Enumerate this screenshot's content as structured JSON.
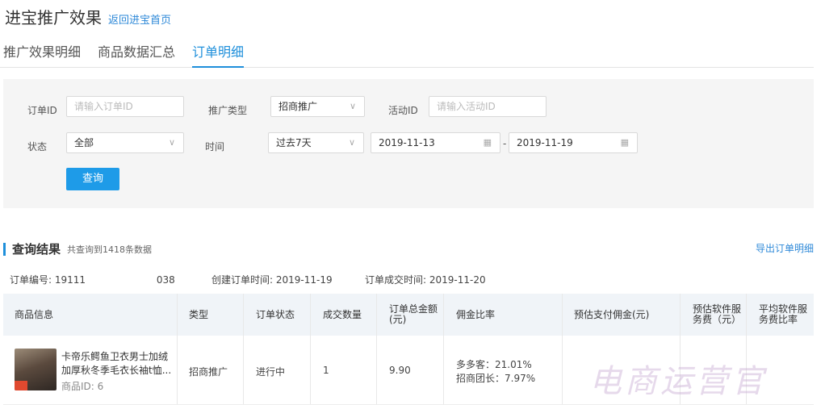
{
  "header": {
    "title": "进宝推广效果",
    "back_link": "返回进宝首页"
  },
  "tabs": [
    "推广效果明细",
    "商品数据汇总",
    "订单明细"
  ],
  "active_tab": "订单明细",
  "filters": {
    "order_id": {
      "label": "订单ID",
      "placeholder": "请输入订单ID"
    },
    "promo_type": {
      "label": "推广类型",
      "value": "招商推广"
    },
    "activity_id": {
      "label": "活动ID",
      "placeholder": "请输入活动ID"
    },
    "status": {
      "label": "状态",
      "value": "全部"
    },
    "time": {
      "label": "时间",
      "range": "过去7天",
      "start": "2019-11-13",
      "end": "2019-11-19",
      "separator": "-"
    },
    "query_button": "查询"
  },
  "results": {
    "title": "查询结果",
    "count_text": "共查询到1418条数据",
    "export": "导出订单明细"
  },
  "order": {
    "number_label": "订单编号:",
    "number_prefix": "19111",
    "number_suffix": "038",
    "created": "创建订单时间: 2019-11-19",
    "completed": "订单成交时间: 2019-11-20"
  },
  "table": {
    "headers": {
      "product": "商品信息",
      "type": "类型",
      "status": "订单状态",
      "qty": "成交数量",
      "amount": "订单总金额(元)",
      "rate": "佣金比率",
      "commission": "预估支付佣金(元)",
      "service_fee": "预估软件服务费（元）",
      "avg_fee": "平均软件服务费比率"
    },
    "row": {
      "name": "卡帝乐鳄鱼卫衣男士加绒加厚秋冬季毛衣长袖t恤...",
      "pid": "商品ID: 6",
      "type": "招商推广",
      "status": "进行中",
      "qty": "1",
      "amount": "9.90",
      "rate1": "多多客：21.01%",
      "rate2": "招商团长：7.97%"
    }
  },
  "watermark": "电商运营官",
  "colors": {
    "accent": "#1e8fdb",
    "button": "#1e9be8",
    "link": "#2e89d8"
  }
}
